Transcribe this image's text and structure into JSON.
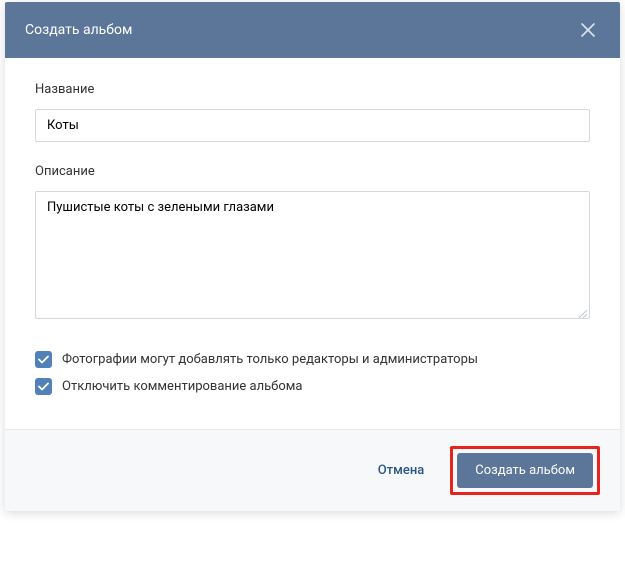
{
  "header": {
    "title": "Создать альбом"
  },
  "fields": {
    "name": {
      "label": "Название",
      "value": "Коты"
    },
    "description": {
      "label": "Описание",
      "value": "Пушистые коты с зелеными глазами"
    }
  },
  "checkboxes": {
    "editors_only": {
      "label": "Фотографии могут добавлять только редакторы и администраторы",
      "checked": true
    },
    "disable_comments": {
      "label": "Отключить комментирование альбома",
      "checked": true
    }
  },
  "footer": {
    "cancel": "Отмена",
    "submit": "Создать альбом"
  }
}
